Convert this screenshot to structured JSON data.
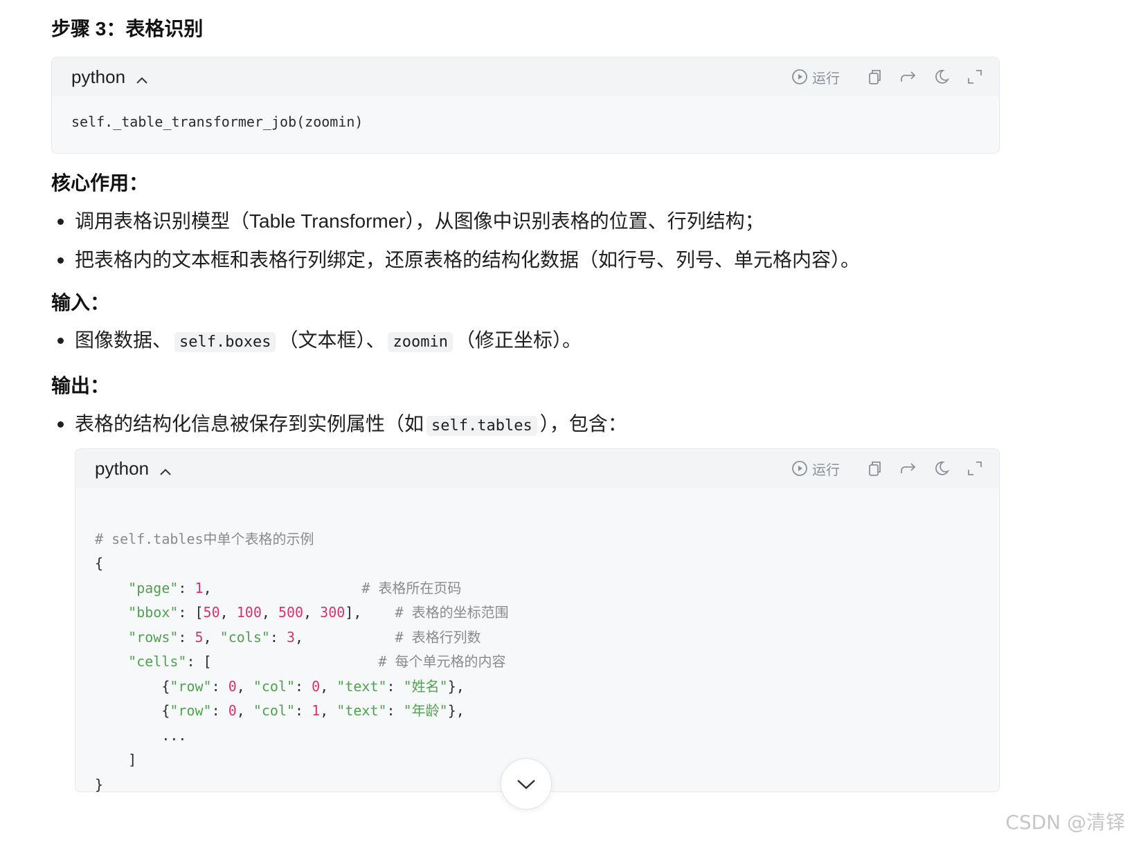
{
  "step_title": "步骤 3：表格识别",
  "code_block_1": {
    "language": "python",
    "run_label": "运行",
    "code_line": "self._table_transformer_job(zoomin)"
  },
  "section_core": {
    "heading": "核心作用：",
    "bullets": [
      "调用表格识别模型（Table Transformer），从图像中识别表格的位置、行列结构；",
      "把表格内的文本框和表格行列绑定，还原表格的结构化数据（如行号、列号、单元格内容）。"
    ]
  },
  "section_input": {
    "heading": "输入：",
    "text_before": "图像数据、",
    "code_1": "self.boxes",
    "text_middle": "（文本框）、",
    "code_2": "zoomin",
    "text_after": "（修正坐标）。"
  },
  "section_output": {
    "heading": "输出：",
    "text_before": "表格的结构化信息被保存到实例属性（如",
    "code": "self.tables",
    "text_after": "），包含："
  },
  "code_block_2": {
    "language": "python",
    "run_label": "运行",
    "comment_line": "# self.tables中单个表格的示例",
    "comment_page": "# 表格所在页码",
    "comment_bbox": "# 表格的坐标范围",
    "comment_rows": "# 表格行列数",
    "comment_cells": "# 每个单元格的内容",
    "key_page": "\"page\"",
    "val_page": "1",
    "key_bbox": "\"bbox\"",
    "bbox_vals": [
      "50",
      "100",
      "500",
      "300"
    ],
    "key_rows": "\"rows\"",
    "val_rows": "5",
    "key_cols": "\"cols\"",
    "val_cols": "3",
    "key_cells": "\"cells\"",
    "key_row": "\"row\"",
    "key_col": "\"col\"",
    "key_text": "\"text\"",
    "cell_1": {
      "row": "0",
      "col": "0",
      "text": "\"姓名\""
    },
    "cell_2": {
      "row": "0",
      "col": "1",
      "text": "\"年龄\""
    },
    "ellipsis": "..."
  },
  "watermark": "CSDN @清铎",
  "colors": {
    "string": "#50a14f",
    "number": "#d6336c",
    "comment": "#8a8a8a",
    "code_bg": "#f7f8fa"
  }
}
